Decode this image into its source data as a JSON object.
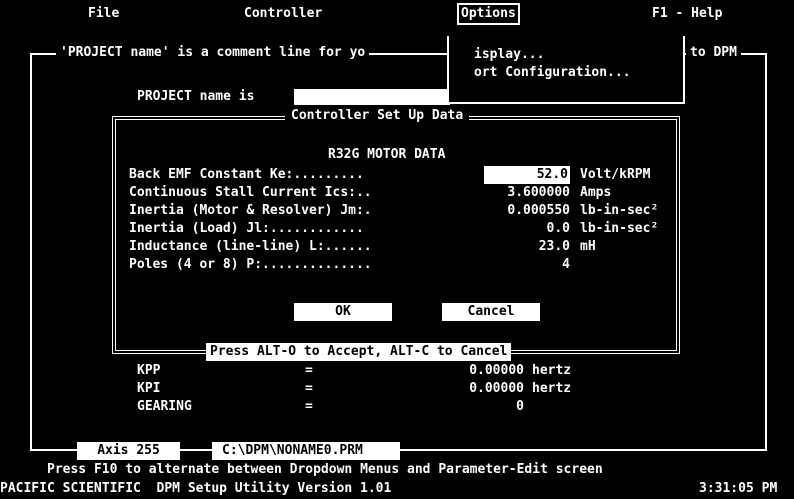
{
  "menu": {
    "file": "File",
    "controller": "Controller",
    "options": "Options",
    "help": "F1 - Help"
  },
  "options_menu": {
    "items": [
      "isplay...",
      "ort Configuration..."
    ]
  },
  "project": {
    "note": "'PROJECT name' is a comment line for yo",
    "note_tail": "to DPM",
    "label": "PROJECT name is",
    "value": ""
  },
  "dialog": {
    "title": "Controller Set Up Data",
    "heading": "R32G MOTOR DATA",
    "rows": [
      {
        "label": "Back EMF Constant Ke:.........",
        "value": "52.0",
        "unit": "Volt/kRPM"
      },
      {
        "label": "Continuous Stall Current Ics:..",
        "value": "3.600000",
        "unit": "Amps"
      },
      {
        "label": "Inertia (Motor & Resolver) Jm:.",
        "value": "0.000550",
        "unit": "lb-in-sec²"
      },
      {
        "label": "Inertia (Load) Jl:............",
        "value": "0.0",
        "unit": "lb-in-sec²"
      },
      {
        "label": "Inductance (line-line) L:......",
        "value": "23.0",
        "unit": "mH"
      },
      {
        "label": "Poles (4 or 8) P:..............",
        "value": "4",
        "unit": ""
      }
    ],
    "ok_label": "OK",
    "cancel_label": "Cancel",
    "hint": "Press ALT-O to Accept, ALT-C to Cancel"
  },
  "params": [
    {
      "name": "KPP",
      "eq": "=",
      "value": "0.00000",
      "unit": "hertz"
    },
    {
      "name": "KPI",
      "eq": "=",
      "value": "0.00000",
      "unit": "hertz"
    },
    {
      "name": "GEARING",
      "eq": "=",
      "value": "0",
      "unit": ""
    }
  ],
  "footer": {
    "axis": "Axis 255",
    "file": "C:\\DPM\\NONAME0.PRM",
    "help": "Press F10 to alternate between Dropdown Menus and Parameter-Edit screen",
    "status": "PACIFIC SCIENTIFIC  DPM Setup Utility Version 1.01",
    "clock": "3:31:05 PM"
  },
  "colors": {
    "background": "#000000",
    "foreground": "#ffffff"
  }
}
